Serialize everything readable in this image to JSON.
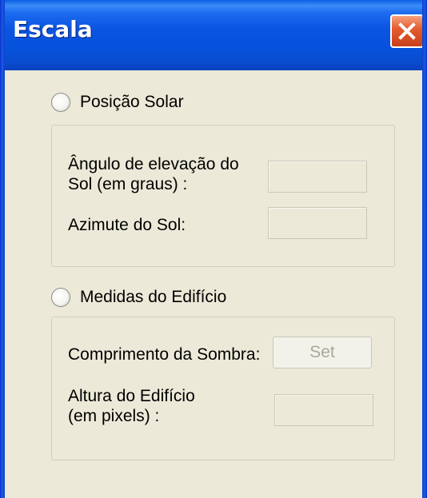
{
  "window": {
    "title": "Escala"
  },
  "options": {
    "solar_position_label": "Posição Solar",
    "building_measures_label": "Medidas do Edifício"
  },
  "solar_group": {
    "elevation_label_line1": "Ângulo de elevação do",
    "elevation_label_line2": "Sol (em graus) :",
    "elevation_value": "",
    "azimuth_label": "Azimute do Sol:",
    "azimuth_value": ""
  },
  "building_group": {
    "shadow_length_label": "Comprimento da Sombra:",
    "set_button_label": "Set",
    "height_label_line1": "Altura do Edifício",
    "height_label_line2": "(em pixels) :",
    "height_value": ""
  },
  "icons": {
    "close": "close-icon"
  },
  "colors": {
    "titlebar": "#0b55e2",
    "close_button": "#e35a2b",
    "client_background": "#ece9d8"
  }
}
